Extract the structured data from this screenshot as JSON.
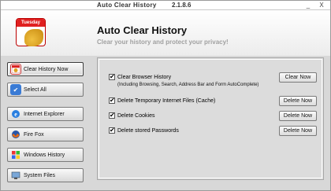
{
  "window": {
    "title": "Auto Clear History",
    "version": "2.1.8.6",
    "minimize_glyph": "_",
    "close_glyph": "X"
  },
  "header": {
    "logo_day": "Tuesday",
    "app_name": "Auto Clear History",
    "slogan": "Clear your history and protect your privacy!"
  },
  "sidebar": {
    "items": [
      {
        "label": "Clear History Now",
        "icon": "calendar-broom-icon"
      },
      {
        "label": "Select All",
        "icon": "checkbox-icon"
      },
      {
        "label": "Internet Explorer",
        "icon": "internet-explorer-icon"
      },
      {
        "label": "Fire Fox",
        "icon": "firefox-icon"
      },
      {
        "label": "Windows History",
        "icon": "windows-history-icon"
      },
      {
        "label": "System Files",
        "icon": "system-files-icon"
      }
    ]
  },
  "options": [
    {
      "label": "Clear Browser History",
      "checked": true,
      "button": "Clear Now",
      "sub": "(Including Browsing, Search, Address Bar and Form AutoComplete)"
    },
    {
      "label": "Delete Temporary Internet Files (Cache)",
      "checked": true,
      "button": "Delete Now"
    },
    {
      "label": "Delete Cookies",
      "checked": true,
      "button": "Delete Now"
    },
    {
      "label": "Delete stored Passwords",
      "checked": true,
      "button": "Delete Now"
    }
  ]
}
